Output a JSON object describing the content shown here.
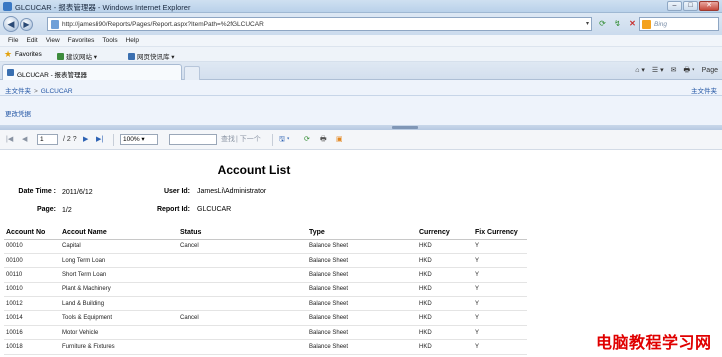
{
  "window": {
    "title": "GLCUCAR - 报表管理器 - Windows Internet Explorer",
    "buttons": [
      "–",
      "□",
      "✕"
    ]
  },
  "address_bar": {
    "url": "http://jamesli90/Reports/Pages/Report.aspx?ItemPath=%2fGLCUCAR",
    "search_placeholder": "Bing"
  },
  "menu": [
    "File",
    "Edit",
    "View",
    "Favorites",
    "Tools",
    "Help"
  ],
  "favorites": {
    "label": "Favorites",
    "items": [
      "建议网站 ▾",
      "网页快讯库 ▾"
    ]
  },
  "tab": {
    "title": "GLCUCAR - 报表管理器"
  },
  "command_tools": [
    "⌂ ▾",
    "☰ ▾",
    "✉",
    "🖶 ▾",
    "Page"
  ],
  "report_manager": {
    "breadcrumb": [
      "主文件夹",
      "GLCUCAR"
    ],
    "breadcrumb_right": "主文件夹",
    "link": "更改凭据"
  },
  "report_toolbar": {
    "first": "|◀",
    "prev": "◀",
    "page": "1",
    "of_pages": "/ 2 ?",
    "next": "▶",
    "last": "▶|",
    "zoom": "100%",
    "find": "查找",
    "next_match": "| 下一个",
    "export": "🖫 ▾",
    "refresh": "⟳",
    "print": "🖶",
    "feed": "▣"
  },
  "report": {
    "title": "Account List",
    "date_label": "Date Time :",
    "date_value": "2011/6/12",
    "page_label": "Page:",
    "page_value": "1/2",
    "user_label": "User Id:",
    "user_value": "JamesLi\\Administrator",
    "report_label": "Report Id:",
    "report_value": "GLCUCAR",
    "columns": [
      "Account No",
      "Accout Name",
      "Status",
      "Type",
      "Currency",
      "Fix Currency"
    ],
    "rows": [
      [
        "00010",
        "Capital",
        "Cancel",
        "Balance Sheet",
        "HKD",
        "Y"
      ],
      [
        "00100",
        "Long Term Loan",
        "",
        "Balance Sheet",
        "HKD",
        "Y"
      ],
      [
        "00110",
        "Short Term Loan",
        "",
        "Balance Sheet",
        "HKD",
        "Y"
      ],
      [
        "10010",
        "Plant & Machinery",
        "",
        "Balance Sheet",
        "HKD",
        "Y"
      ],
      [
        "10012",
        "Land & Building",
        "",
        "Balance Sheet",
        "HKD",
        "Y"
      ],
      [
        "10014",
        "Tools & Equipment",
        "Cancel",
        "Balance Sheet",
        "HKD",
        "Y"
      ],
      [
        "10016",
        "Motor Vehicle",
        "",
        "Balance Sheet",
        "HKD",
        "Y"
      ],
      [
        "10018",
        "Furniture & Fixtures",
        "",
        "Balance Sheet",
        "HKD",
        "Y"
      ]
    ]
  },
  "watermark": "电脑教程学习网"
}
